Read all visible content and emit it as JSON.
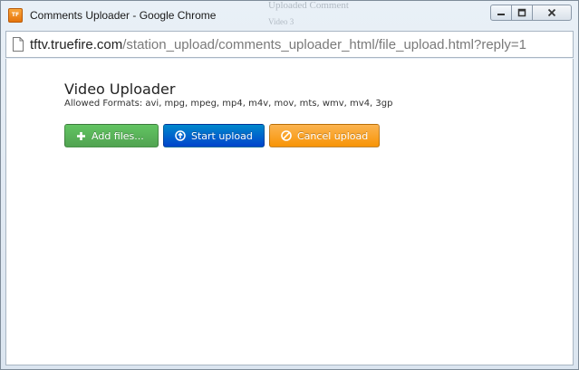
{
  "window": {
    "title": "Comments Uploader - Google Chrome",
    "background_text_line1": "Uploaded Comment",
    "background_text_line2": "Video 3",
    "controls": {
      "minimize": "minimize",
      "maximize": "maximize",
      "close": "close"
    }
  },
  "address_bar": {
    "domain": "tftv.truefire.com",
    "path": "/station_upload/comments_uploader_html/file_upload.html?reply=1"
  },
  "uploader": {
    "heading": "Video Uploader",
    "formats": "Allowed Formats: avi, mpg, mpeg, mp4, m4v, mov, mts, wmv, mv4, 3gp",
    "add_files_label": "Add files...",
    "start_upload_label": "Start upload",
    "cancel_upload_label": "Cancel upload"
  },
  "colors": {
    "add_files": "#5bb75b",
    "start_upload": "#0066cc",
    "cancel_upload": "#faa732"
  },
  "icons": [
    "plus-icon",
    "upload-circle-icon",
    "ban-icon",
    "page-icon",
    "minimize-icon",
    "maximize-icon",
    "close-icon"
  ]
}
